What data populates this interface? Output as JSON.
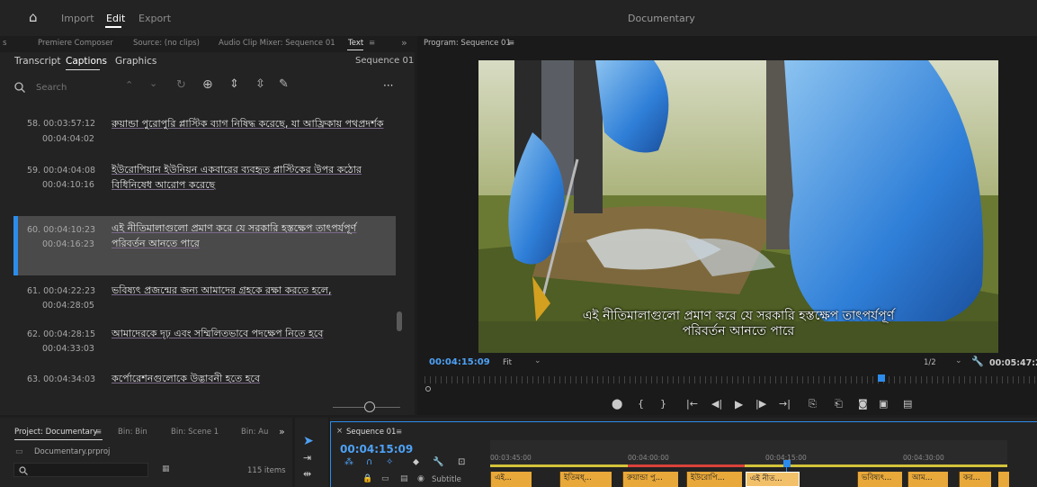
{
  "topbar": {
    "home_label": "⌂",
    "import": "Import",
    "edit": "Edit",
    "export": "Export",
    "title": "Documentary"
  },
  "left_panel": {
    "tabs": [
      "s",
      "Premiere Composer",
      "Source: (no clips)",
      "Audio Clip Mixer: Sequence 01",
      "Text",
      "≡",
      "»"
    ],
    "subtabs": {
      "transcript": "Transcript",
      "captions": "Captions",
      "graphics": "Graphics",
      "sequence": "Sequence 01"
    },
    "search_placeholder": "Search",
    "more": "···",
    "captions": [
      {
        "index": "58.",
        "start": "00:03:57:12",
        "end": "00:04:04:02",
        "text": "রুয়ান্ডা পুরোপুরি প্লাস্টিক ব্যাগ নিষিদ্ধ করেছে, যা আফ্রিকায় পথপ্রদর্শক"
      },
      {
        "index": "59.",
        "start": "00:04:04:08",
        "end": "00:04:10:16",
        "text": "ইউরোপিয়ান ইউনিয়ন একবারের ব্যবহৃত প্লাস্টিকের উপর কঠোর বিধিনিষেধ আরোপ করেছে"
      },
      {
        "index": "60.",
        "start": "00:04:10:23",
        "end": "00:04:16:23",
        "text": "এই নীতিমালাগুলো প্রমাণ করে যে সরকারি হস্তক্ষেপ তাৎপর্যপূর্ণ পরিবর্তন আনতে পারে"
      },
      {
        "index": "61.",
        "start": "00:04:22:23",
        "end": "00:04:28:05",
        "text": "ভবিষ্যৎ প্রজন্মের জন্য আমাদের গ্রহকে রক্ষা করতে হলে,"
      },
      {
        "index": "62.",
        "start": "00:04:28:15",
        "end": "00:04:33:03",
        "text": "আমাদেরকে দৃঢ় এবং সম্মিলিতভাবে পদক্ষেপ নিতে হবে"
      },
      {
        "index": "63.",
        "start": "00:04:34:03",
        "end": "",
        "text": "কর্পোরেশনগুলোকে উদ্ভাবনী হতে হবে"
      }
    ]
  },
  "program": {
    "tab": "Program: Sequence 01",
    "menu": "≡",
    "subtitle_line1": "এই নীতিমালাগুলো প্রমাণ করে যে সরকারি হস্তক্ষেপ তাৎপর্যপূর্ণ",
    "subtitle_line2": "পরিবর্তন আনতে পারে",
    "timecode": "00:04:15:09",
    "fit": "Fit",
    "resolution": "1/2",
    "duration": "00:05:47:2"
  },
  "project": {
    "tab": "Project: Documentary",
    "menu": "≡",
    "bins": [
      "Bin: Bin",
      "Bin: Scene 1",
      "Bin: Au"
    ],
    "more": "»",
    "file": "Documentary.prproj",
    "items": "115 items"
  },
  "timeline": {
    "tab": "Sequence 01",
    "menu": "≡",
    "timecode": "00:04:15:09",
    "ruler": [
      "00:03:45:00",
      "00:04:00:00",
      "00:04:15:00",
      "00:04:30:00"
    ],
    "track_label": "Subtitle",
    "clips": [
      "এই...",
      "ইতিমধ্...",
      "রুয়ান্ডা পু...",
      "ইউরোপি...",
      "এই নীত...",
      "ভবিষ্যৎ...",
      "আম...",
      "কর..."
    ]
  },
  "colors": {
    "accent_blue": "#2d8ceb",
    "clip_orange": "#e8a83a",
    "selected_caption": "#4a4a4a"
  }
}
